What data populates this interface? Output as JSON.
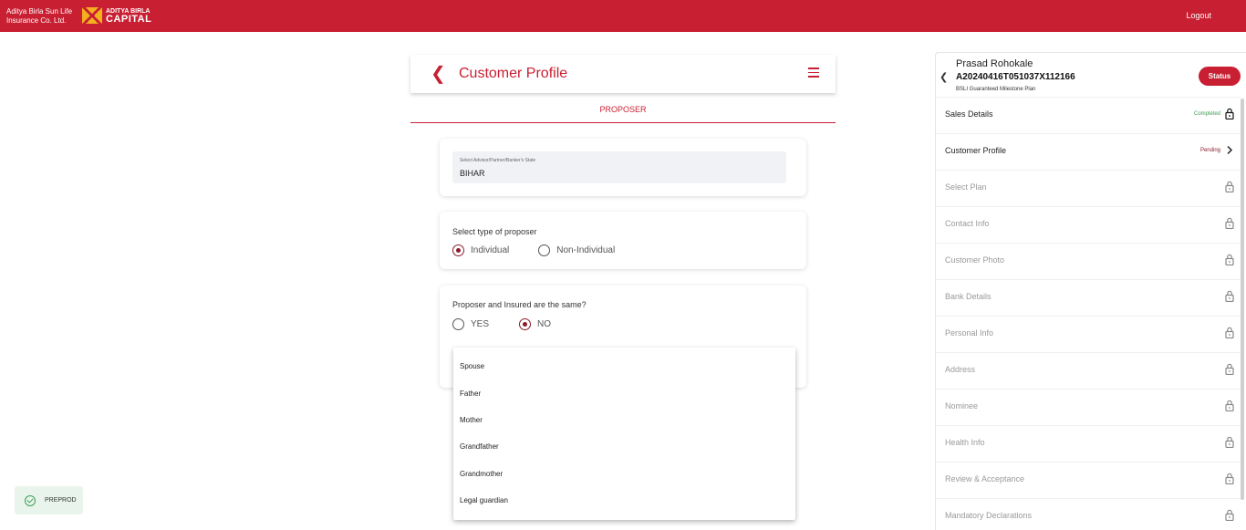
{
  "header": {
    "brand_line1": "Aditya Birla Sun Life",
    "brand_line2": "Insurance Co. Ltd.",
    "capital_line1": "ADITYA BIRLA",
    "capital_line2": "CAPITAL",
    "logout_label": "Logout",
    "bar_color": "#c91f32"
  },
  "page": {
    "title": "Customer Profile",
    "tab_label": "PROPOSER"
  },
  "state_field": {
    "label": "Select Advisor/Partner/Banker's State",
    "value": "BIHAR"
  },
  "proposer_type": {
    "question": "Select type of proposer",
    "options": [
      "Individual",
      "Non-Individual"
    ],
    "selected": "Individual"
  },
  "same_insured": {
    "question": "Proposer and Insured are the same?",
    "options": [
      "YES",
      "NO"
    ],
    "selected": "NO"
  },
  "relationship_dropdown": {
    "options": [
      "Spouse",
      "Father",
      "Mother",
      "Grandfather",
      "Grandmother",
      "Legal guardian"
    ]
  },
  "env_badge": {
    "label": "PREPROD"
  },
  "side_panel": {
    "name": "Prasad Rohokale",
    "application_id": "A20240416T051037X112166",
    "plan": "BSLI Guaranteed Milestone Plan",
    "status_label": "Status",
    "steps": [
      {
        "name": "Sales Details",
        "status": "Completed",
        "state": "done"
      },
      {
        "name": "Customer Profile",
        "status": "Pending",
        "state": "pending"
      },
      {
        "name": "Select Plan",
        "status": "",
        "state": "locked"
      },
      {
        "name": "Contact Info",
        "status": "",
        "state": "locked"
      },
      {
        "name": "Customer Photo",
        "status": "",
        "state": "locked"
      },
      {
        "name": "Bank Details",
        "status": "",
        "state": "locked"
      },
      {
        "name": "Personal Info",
        "status": "",
        "state": "locked"
      },
      {
        "name": "Address",
        "status": "",
        "state": "locked"
      },
      {
        "name": "Nominee",
        "status": "",
        "state": "locked"
      },
      {
        "name": "Health Info",
        "status": "",
        "state": "locked"
      },
      {
        "name": "Review & Acceptance",
        "status": "",
        "state": "locked"
      },
      {
        "name": "Mandatory Declarations",
        "status": "",
        "state": "locked"
      }
    ]
  }
}
